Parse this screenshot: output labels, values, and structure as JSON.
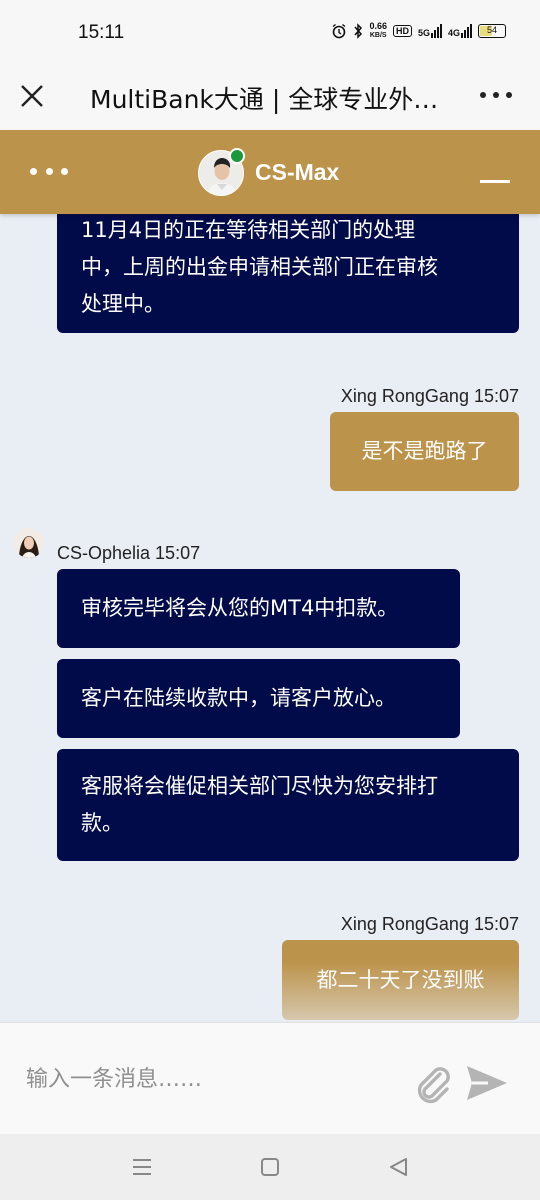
{
  "status_bar": {
    "time": "15:11",
    "net_speed_value": "0.66",
    "net_speed_unit": "KB/S",
    "hd_badge": "HD",
    "signal_5g": "5G",
    "signal_4g": "4G",
    "battery_level": "54",
    "battery_color": "#e9dc7c"
  },
  "title_bar": {
    "title": "MultiBank大通 | 全球专业外…",
    "close_icon": "close-icon",
    "more_icon": "more-dots-icon"
  },
  "chat_header": {
    "agent_name": "CS-Max",
    "status": "online",
    "status_color": "#1a9a3a",
    "brand_color": "#bc934b",
    "menu_icon": "dots-menu-icon",
    "minimize_icon": "minimize-icon"
  },
  "messages": [
    {
      "sender": "agent",
      "text_lines": [
        "11月4日的正在等待相关部门的处理",
        "中，上周的出金申请相关部门正在审核",
        "处理中。"
      ]
    },
    {
      "sender": "user",
      "name": "Xing RongGang",
      "time": "15:07",
      "header": "Xing RongGang 15:07",
      "text": "是不是跑路了"
    },
    {
      "sender": "agent",
      "name": "CS-Ophelia",
      "time": "15:07",
      "header": "CS-Ophelia 15:07",
      "text": "审核完毕将会从您的MT4中扣款。"
    },
    {
      "sender": "agent",
      "text": "客户在陆续收款中，请客户放心。"
    },
    {
      "sender": "agent",
      "text_lines": [
        "客服将会催促相关部门尽快为您安排打",
        "款。"
      ]
    },
    {
      "sender": "user",
      "name": "Xing RongGang",
      "time": "15:07",
      "header": "Xing RongGang 15:07",
      "text": "都二十天了没到账"
    }
  ],
  "colors": {
    "agent_bubble": "#020b4a",
    "user_bubble": "#bc934b",
    "chat_background": "#e9edf4"
  },
  "input": {
    "placeholder": "输入一条消息……",
    "value": "",
    "attach_icon": "paperclip-icon",
    "send_icon": "send-icon"
  },
  "nav_bar": {
    "menu_icon": "menu-icon",
    "home_icon": "home-square-icon",
    "back_icon": "back-triangle-icon"
  }
}
